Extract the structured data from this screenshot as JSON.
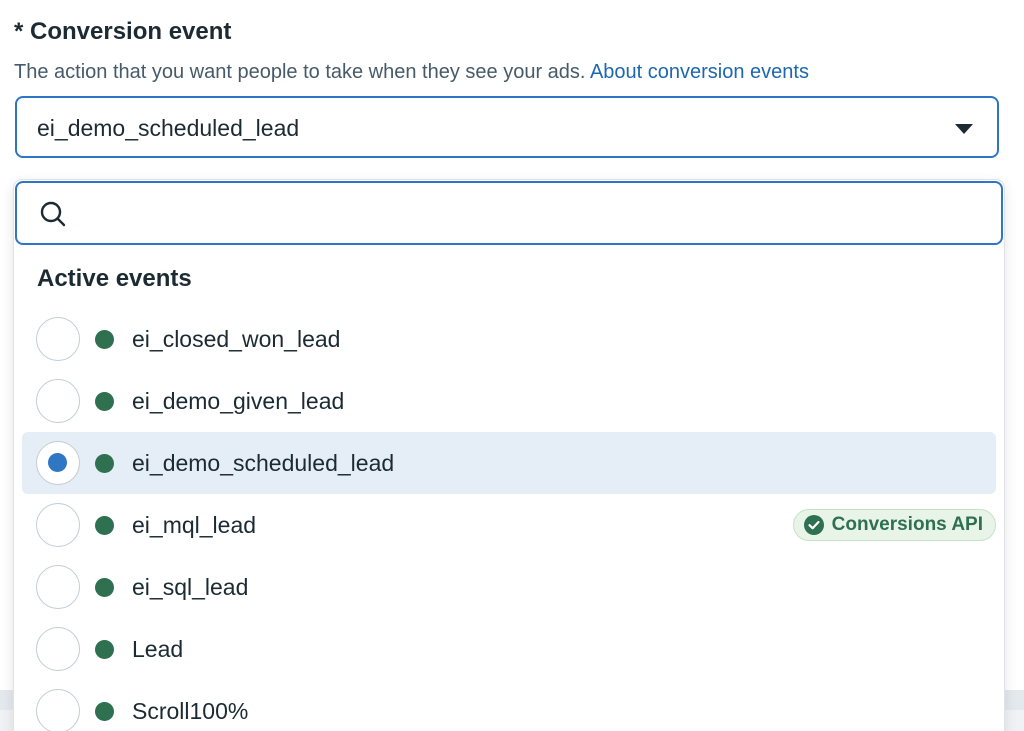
{
  "field": {
    "label": "* Conversion event",
    "description": "The action that you want people to take when they see your ads.",
    "link_text": "About conversion events"
  },
  "select": {
    "value": "ei_demo_scheduled_lead",
    "caret_icon": "caret-down-icon"
  },
  "search": {
    "placeholder": "",
    "icon": "search-icon"
  },
  "section": {
    "title": "Active events"
  },
  "events": [
    {
      "name": "ei_closed_won_lead",
      "selected": false,
      "badge": ""
    },
    {
      "name": "ei_demo_given_lead",
      "selected": false,
      "badge": ""
    },
    {
      "name": "ei_demo_scheduled_lead",
      "selected": true,
      "badge": ""
    },
    {
      "name": "ei_mql_lead",
      "selected": false,
      "badge": "Conversions API"
    },
    {
      "name": "ei_sql_lead",
      "selected": false,
      "badge": ""
    },
    {
      "name": "Lead",
      "selected": false,
      "badge": ""
    },
    {
      "name": "Scroll100%",
      "selected": false,
      "badge": ""
    }
  ],
  "colors": {
    "accent": "#2e76c4",
    "status_active": "#2e7050",
    "selected_row": "#e5edf6",
    "link": "#1d67b0"
  }
}
